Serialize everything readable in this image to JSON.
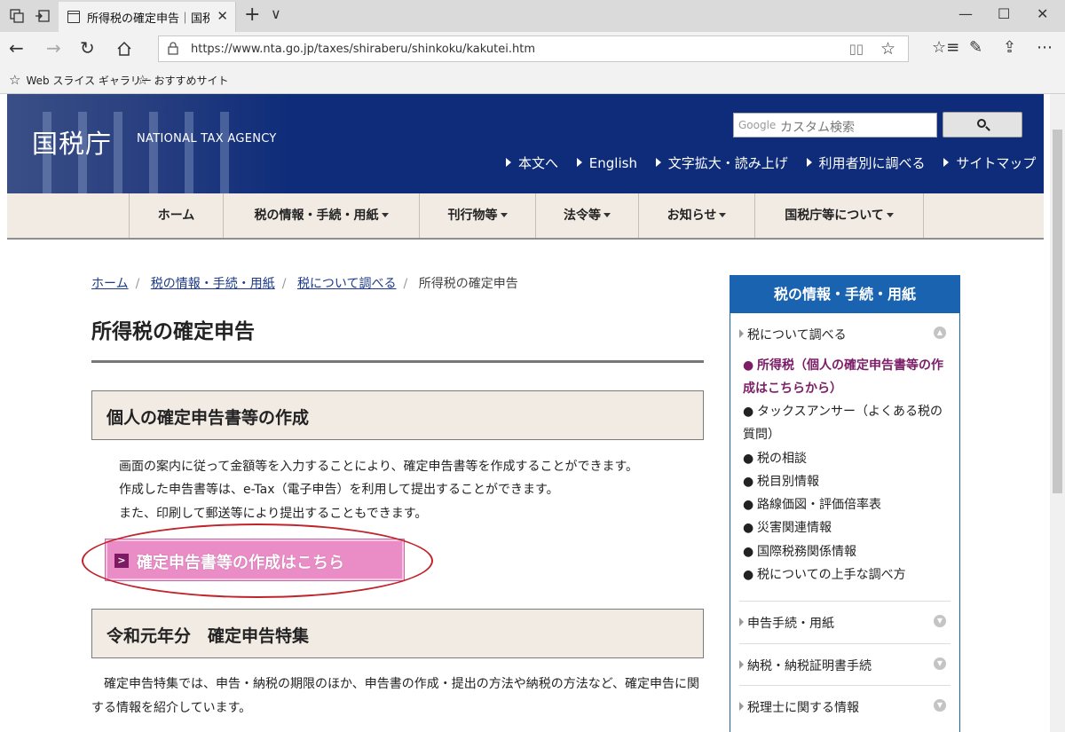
{
  "browser": {
    "tab_title": "所得税の確定申告｜国税庁",
    "tab_close": "✕",
    "new_tab": "+",
    "tab_menu": "∨",
    "url": "https://www.nta.go.jp/taxes/shiraberu/shinkoku/kakutei.htm",
    "favorites": [
      {
        "label": "Web スライス ギャラリー"
      },
      {
        "label": "おすすめサイト"
      }
    ]
  },
  "header": {
    "logo": "国税庁",
    "logo_en": "NATIONAL TAX AGENCY",
    "search_brand": "Google",
    "search_placeholder": "カスタム検索",
    "links": [
      "本文へ",
      "English",
      "文字拡大・読み上げ",
      "利用者別に調べる",
      "サイトマップ"
    ],
    "header_bg": "#0e2c7a"
  },
  "gnav": {
    "items": [
      "ホーム",
      "税の情報・手続・用紙",
      "刊行物等",
      "法令等",
      "お知らせ",
      "国税庁等について"
    ]
  },
  "breadcrumb": {
    "items": [
      "ホーム",
      "税の情報・手続・用紙",
      "税について調べる"
    ],
    "current": "所得税の確定申告"
  },
  "page": {
    "title": "所得税の確定申告",
    "section1_title": "個人の確定申告書等の作成",
    "section1_lines": [
      "画面の案内に従って金額等を入力することにより、確定申告書等を作成することができます。",
      "作成した申告書等は、e-Tax（電子申告）を利用して提出することができます。",
      "また、印刷して郵送等により提出することもできます。"
    ],
    "cta_label": "確定申告書等の作成はこちら",
    "cta_arrow": ">",
    "cta_color": "#ea8cc6",
    "section2_title": "令和元年分　確定申告特集",
    "section2_text": "確定申告特集では、申告・納税の期限のほか、申告書の作成・提出の方法や納税の方法など、確定申告に関する情報を紹介しています。"
  },
  "side": {
    "heading": "税の情報・手続・用紙",
    "heading_color": "#1a63b1",
    "top_item": "税について調べる",
    "sub_items": [
      {
        "label": "所得税（個人の確定申告書等の作成はこちらから）",
        "active": true
      },
      {
        "label": "タックスアンサー（よくある税の質問）",
        "active": false
      },
      {
        "label": "税の相談",
        "active": false
      },
      {
        "label": "税目別情報",
        "active": false
      },
      {
        "label": "路線価図・評価倍率表",
        "active": false
      },
      {
        "label": "災害関連情報",
        "active": false
      },
      {
        "label": "国際税務関係情報",
        "active": false
      },
      {
        "label": "税についての上手な調べ方",
        "active": false
      }
    ],
    "other_items": [
      "申告手続・用紙",
      "納税・納税証明書手続",
      "税理士に関する情報"
    ],
    "bullet": "●"
  }
}
